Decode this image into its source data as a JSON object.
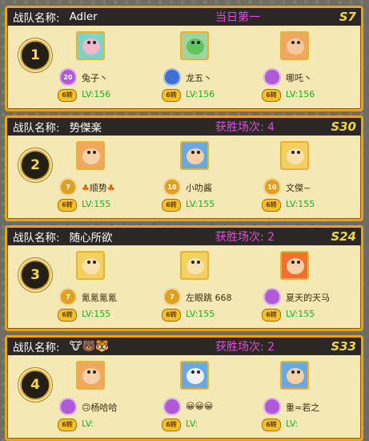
{
  "labels": {
    "team": "战队名称:",
    "lv_prefix": "LV:",
    "tier": "6转"
  },
  "teams": [
    {
      "rank": "1",
      "name": "Adler",
      "stat": "当日第一",
      "server": "S7",
      "members": [
        {
          "name": "兔子丶",
          "level": "156",
          "badge": "20",
          "badge_color": "#b05ad8",
          "avatar_color": "#7fd3c4",
          "face": "#f0b8c8"
        },
        {
          "name": "龙五丶",
          "level": "156",
          "badge": "",
          "badge_color": "#3f6fd1",
          "avatar_color": "#9fd3a0",
          "face": "#5ec45e"
        },
        {
          "name": "哪吒丶",
          "level": "156",
          "badge": "",
          "badge_color": "#b05ad8",
          "avatar_color": "#f0a860",
          "face": "#f5c9a0"
        }
      ]
    },
    {
      "rank": "2",
      "name": "势傑楽",
      "stat": "获胜场次: 4",
      "server": "S30",
      "members": [
        {
          "name": "顺势",
          "level": "155",
          "badge": "7",
          "badge_color": "#e0a020",
          "avatar_color": "#f0a860",
          "face": "#f5d0a8",
          "leaves": true
        },
        {
          "name": "小叻酱",
          "level": "155",
          "badge": "10",
          "badge_color": "#e0a020",
          "avatar_color": "#6aa8e0",
          "face": "#f5d0a8"
        },
        {
          "name": "文傑~",
          "level": "155",
          "badge": "10",
          "badge_color": "#e0a020",
          "avatar_color": "#f4d060",
          "face": "#f8e3b0"
        }
      ]
    },
    {
      "rank": "3",
      "name": "随心所欲",
      "stat": "获胜场次: 2",
      "server": "S24",
      "members": [
        {
          "name": "氪氪氪氪",
          "level": "155",
          "badge": "7",
          "badge_color": "#e0a020",
          "avatar_color": "#f4d060",
          "face": "#f8e3b0"
        },
        {
          "name": "左眼跳 668",
          "level": "155",
          "badge": "7",
          "badge_color": "#e0a020",
          "avatar_color": "#f4d060",
          "face": "#f8e3b0"
        },
        {
          "name": "夏天的天马",
          "level": "155",
          "badge": "",
          "badge_color": "#b05ad8",
          "avatar_color": "#f07030",
          "face": "#f5d0a8"
        }
      ]
    },
    {
      "rank": "4",
      "name": "🐮🐻🐯",
      "stat": "获胜场次: 2",
      "server": "S33",
      "members": [
        {
          "name": "🙃杨哈哈",
          "level": "",
          "badge": "",
          "badge_color": "#b05ad8",
          "avatar_color": "#f0a860",
          "face": "#f5d0a8"
        },
        {
          "name": "😀😀😀",
          "level": "",
          "badge": "",
          "badge_color": "#b05ad8",
          "avatar_color": "#6aa8e0",
          "face": "#f0f0f0"
        },
        {
          "name": "重≈若之",
          "level": "",
          "badge": "",
          "badge_color": "#b05ad8",
          "avatar_color": "#6aa8e0",
          "face": "#f5d0a8"
        }
      ]
    }
  ]
}
